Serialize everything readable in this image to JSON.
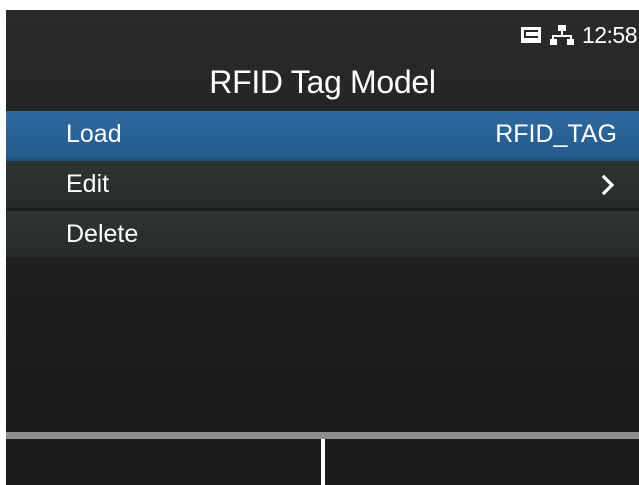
{
  "status": {
    "time": "12:58",
    "icons": [
      "sd-card-icon",
      "network-icon"
    ]
  },
  "header": {
    "title": "RFID Tag Model"
  },
  "menu": {
    "items": [
      {
        "label": "Load",
        "value": "RFID_TAG",
        "selected": true
      },
      {
        "label": "Edit",
        "icon": "chevron-right-icon"
      },
      {
        "label": "Delete"
      }
    ]
  },
  "softkeys": {
    "left": "",
    "right": ""
  },
  "colors": {
    "selected": "#2f6aa0",
    "item_bg": "#2b312d",
    "screen_bg": "#222222",
    "softkey_border": "#8e8e8e"
  }
}
